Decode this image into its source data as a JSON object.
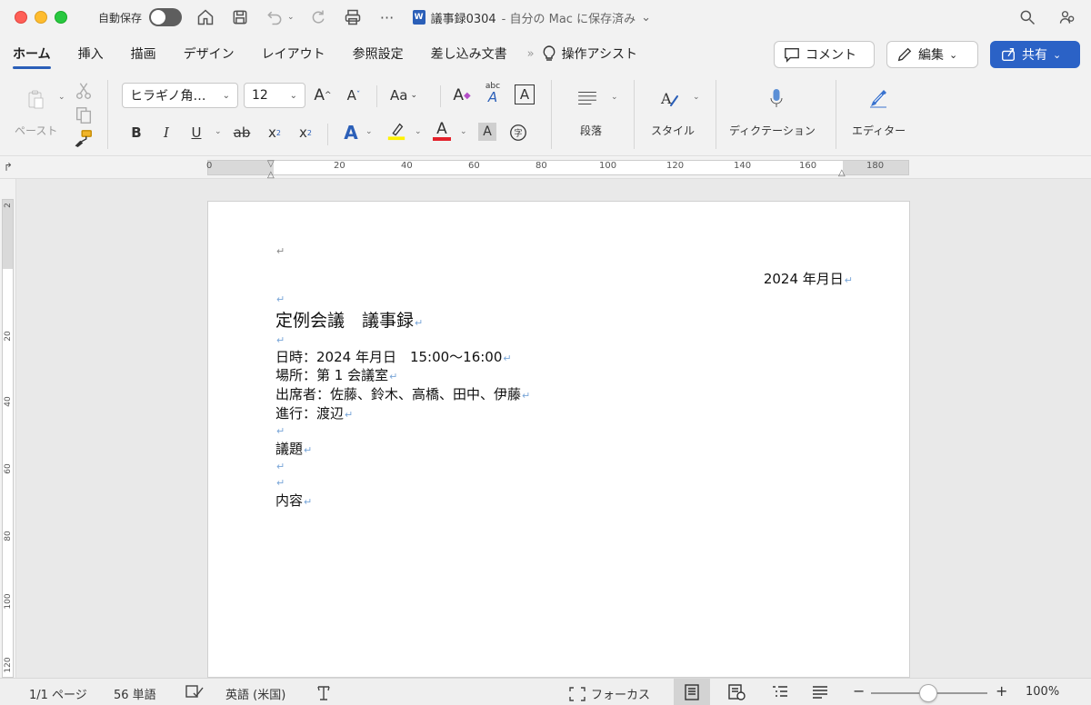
{
  "titlebar": {
    "autosave_label": "自動保存",
    "doc_name": "議事録0304",
    "doc_location": "- 自分の Mac に保存済み",
    "word_badge": "W"
  },
  "tabs": [
    "ホーム",
    "挿入",
    "描画",
    "デザイン",
    "レイアウト",
    "参照設定",
    "差し込み文書"
  ],
  "assist_label": "操作アシスト",
  "actions": {
    "comment": "コメント",
    "edit": "編集",
    "share": "共有"
  },
  "ribbon": {
    "paste_label": "ペースト",
    "font_name": "ヒラギノ角…",
    "font_size": "12",
    "paragraph_label": "段落",
    "style_label": "スタイル",
    "dictation_label": "ディクテーション",
    "editor_label": "エディター",
    "bold": "B",
    "italic": "I",
    "underline": "U",
    "strike": "ab",
    "sub": "x",
    "sup": "x",
    "aa": "Aa",
    "abc": "abc"
  },
  "ruler": {
    "ticks": [
      "0",
      "20",
      "40",
      "60",
      "80",
      "100",
      "120",
      "140",
      "160",
      "180"
    ]
  },
  "vruler": {
    "ticks": [
      "2",
      "20",
      "40",
      "60",
      "80",
      "100",
      "120"
    ]
  },
  "document": {
    "date": "2024 年月日",
    "title": "定例会議　議事録",
    "lines": [
      "日時：2024 年月日　15:00〜16:00",
      "場所：第 1 会議室",
      "出席者：佐藤、鈴木、高橋、田中、伊藤",
      "進行：渡辺"
    ],
    "agenda": "議題",
    "content": "内容",
    "para_mark": "↵"
  },
  "status": {
    "page": "1/1 ページ",
    "words": "56 単語",
    "language": "英語 (米国)",
    "focus": "フォーカス",
    "zoom": "100%",
    "zoom_minus": "−",
    "zoom_plus": "+"
  },
  "colors": {
    "accent": "#2b5fb8",
    "share_bg": "#2b62c6",
    "para_mark": "#7aa6d8"
  }
}
